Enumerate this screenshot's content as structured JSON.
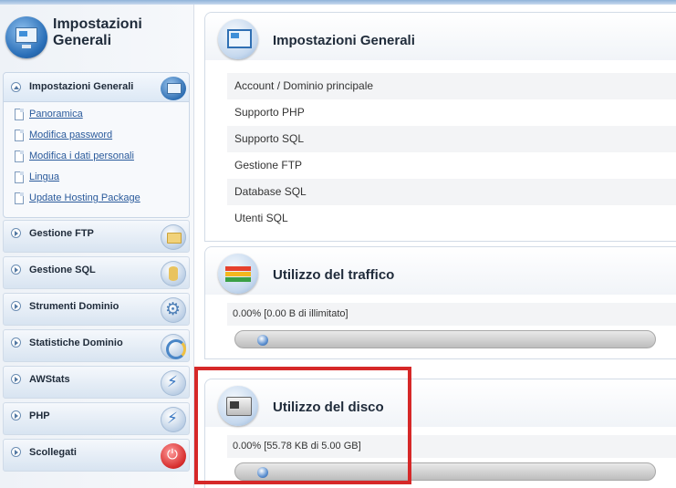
{
  "sidebar": {
    "header_title": "Impostazioni Generali",
    "panel": {
      "title": "Impostazioni Generali",
      "links": [
        "Panoramica",
        "Modifica password",
        "Modifica i dati personali",
        "Lingua",
        "Update Hosting Package"
      ]
    },
    "items": [
      {
        "label": "Gestione FTP",
        "icon": "folder-icon"
      },
      {
        "label": "Gestione SQL",
        "icon": "database-icon"
      },
      {
        "label": "Strumenti Dominio",
        "icon": "gear-icon"
      },
      {
        "label": "Statistiche Dominio",
        "icon": "chart-icon"
      },
      {
        "label": "AWStats",
        "icon": "lightning-icon"
      },
      {
        "label": "PHP",
        "icon": "lightning-icon"
      },
      {
        "label": "Scollegati",
        "icon": "power-icon"
      }
    ]
  },
  "main": {
    "general": {
      "title": "Impostazioni Generali",
      "rows": [
        "Account / Dominio principale",
        "Supporto PHP",
        "Supporto SQL",
        "Gestione FTP",
        "Database SQL",
        "Utenti SQL"
      ]
    },
    "traffic": {
      "title": "Utilizzo del traffico",
      "stat": "0.00% [0.00 B di illimitato]",
      "progress_percent": 0.0
    },
    "disk": {
      "title": "Utilizzo del disco",
      "stat": "0.00% [55.78 KB di 5.00 GB]",
      "progress_percent": 0.0
    }
  },
  "colors": {
    "highlight_border": "#d62828",
    "link": "#2a5a9b"
  }
}
